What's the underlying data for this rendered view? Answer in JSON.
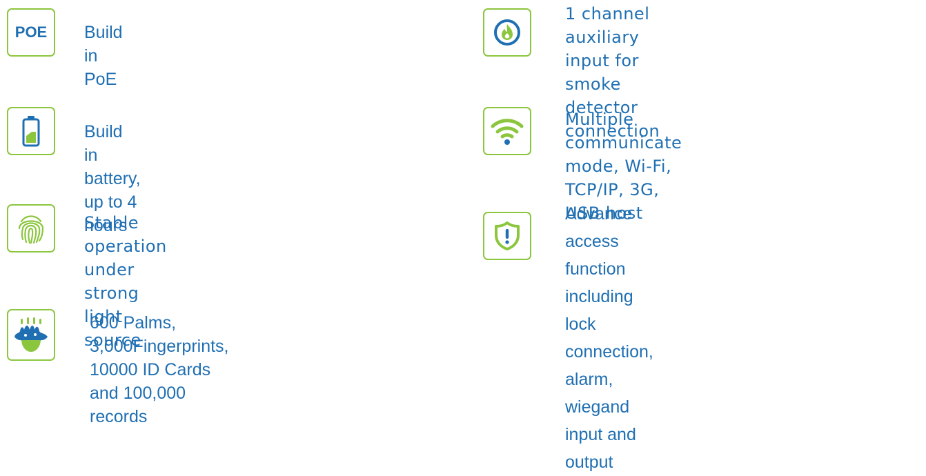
{
  "colors": {
    "text": "#1f6fb2",
    "border": "#8cc63f",
    "icon_blue": "#1f6fb2",
    "icon_green": "#8cc63f"
  },
  "features": {
    "poe": {
      "icon_label": "POE",
      "icon_name": "poe-icon",
      "text": "Build in PoE"
    },
    "battery": {
      "icon_name": "battery-icon",
      "text": "Build in battery, up to 4 hours"
    },
    "fingerprint": {
      "icon_name": "fingerprint-icon",
      "text": "Stable operation under strong\nlight source"
    },
    "palm": {
      "icon_name": "palm-icon",
      "text": "600 Palms, 3,000Fingerprints,\n10000 ID Cards and 100,000 records"
    },
    "smoke": {
      "icon_name": "fire-icon",
      "text": "1 channel auxiliary input for smoke\ndetector connection"
    },
    "wifi": {
      "icon_name": "wifi-icon",
      "text": "Multiple communicate mode, Wi-Fi,\nTCP/IP, 3G, USB host"
    },
    "access": {
      "icon_name": "shield-alert-icon",
      "text": "Advance access function including lock\nconnection, alarm, wiegand input and\noutput"
    }
  }
}
